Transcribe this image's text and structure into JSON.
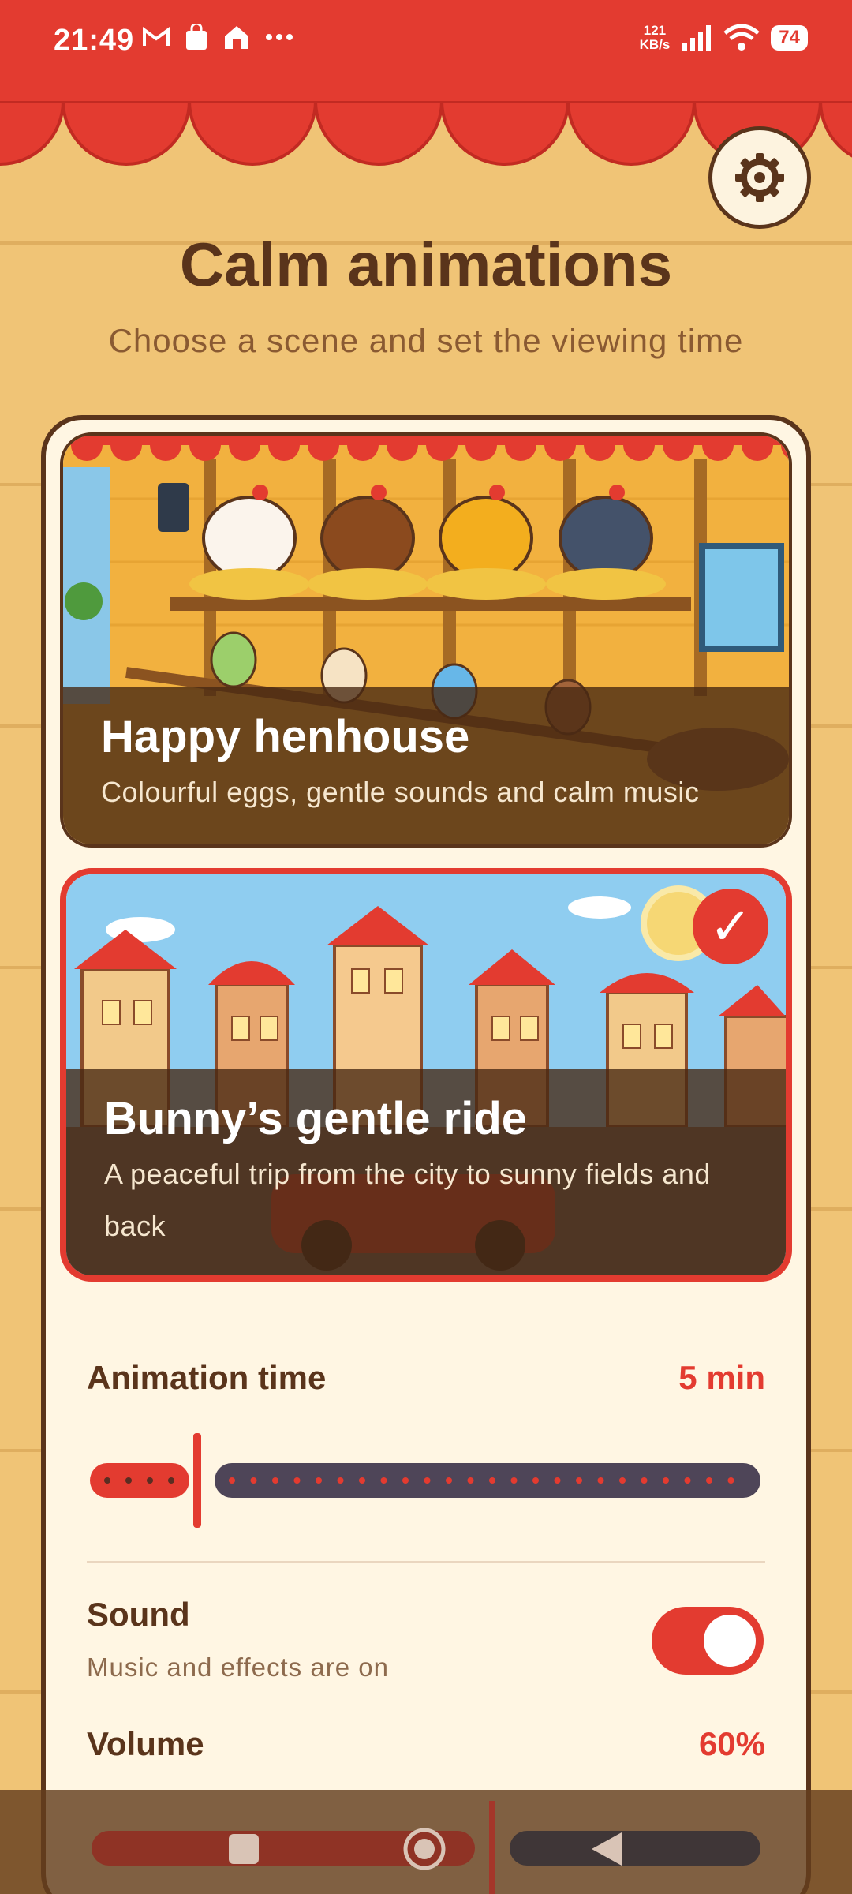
{
  "status_bar": {
    "time": "21:49",
    "net_speed_value": "121",
    "net_speed_unit": "KB/s",
    "battery": "74",
    "notification_icons": [
      "gmail-icon",
      "shopping-bag-icon",
      "home-app-icon",
      "more-dots-icon"
    ]
  },
  "header": {
    "title": "Calm animations",
    "subtitle": "Choose a scene and set the viewing time"
  },
  "scenes": [
    {
      "title": "Happy henhouse",
      "description": "Colourful eggs, gentle sounds and calm music",
      "selected": false
    },
    {
      "title": "Bunny’s gentle ride",
      "description": "A peaceful trip from the city to sunny fields and back",
      "selected": true
    }
  ],
  "settings": {
    "animation_time_label": "Animation time",
    "animation_time_value": "5 min",
    "animation_time_fraction": 0.16,
    "sound_label": "Sound",
    "sound_status": "Music and effects are on",
    "sound_on": true,
    "volume_label": "Volume",
    "volume_value": "60%",
    "volume_fraction": 0.6
  },
  "colors": {
    "primary_red": "#e33b30",
    "brown": "#5a341b",
    "background": "#f0c476",
    "panel": "#fff6e3"
  }
}
